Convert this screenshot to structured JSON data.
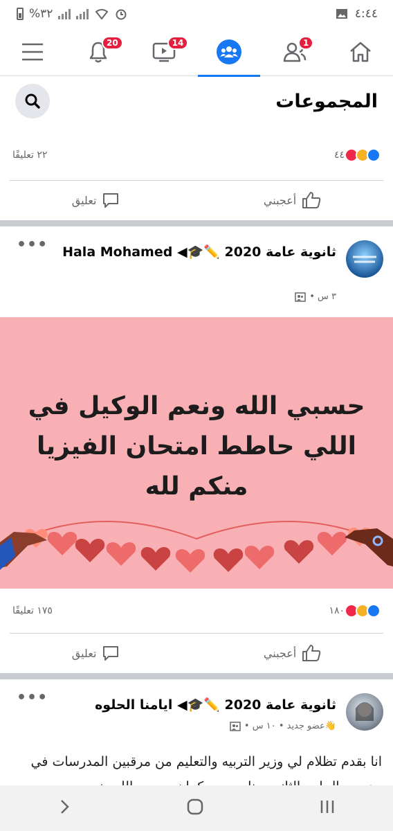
{
  "status": {
    "time": "٤:٤٤",
    "battery_text": "%٣٢"
  },
  "nav": {
    "notifications_badge": "20",
    "watch_badge": "14",
    "friends_badge": "1"
  },
  "groups": {
    "title": "المجموعات"
  },
  "top_post_stats": {
    "reaction_count": "٤٤",
    "comment_count": "٢٢ تعليقًا",
    "like_label": "أعجبني",
    "comment_label": "تعليق"
  },
  "post1": {
    "title": "ثانوية عامة 2020 ✏️🎓◀ Hala Mohamed",
    "time": "٣ س •",
    "image_text": "حسبي الله ونعم الوكيل في اللي حاطط امتحان الفيزيا منكم لله",
    "reaction_count": "١٨٠",
    "comment_count": "١٧٥ تعليقًا",
    "like_label": "أعجبني",
    "comment_label": "تعليق"
  },
  "post2": {
    "title": "ثانوية عامة 2020 ✏️🎓◀ ايامنا الحلوه",
    "meta": "👋عضو جديد • ١٠ س •",
    "text": "انا بقدم تظلام لي وزير التربيه والتعليم من مرقبين المدرسات في مدرسه الجابيه الثانويه بنات ومن كمان حسبي الله ونعم"
  },
  "colors": {
    "facebook_blue": "#1877f2",
    "badge_red": "#e41e3f",
    "image_background": "#f9b0b4"
  }
}
